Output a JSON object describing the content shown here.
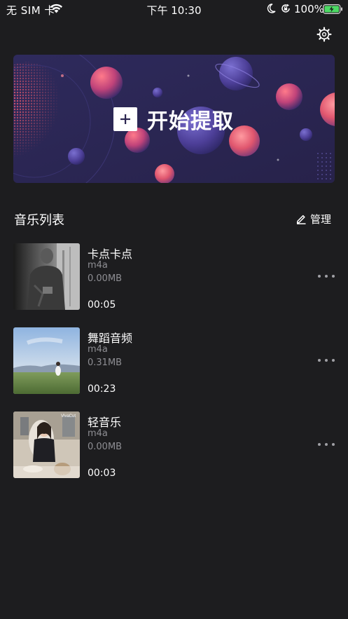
{
  "status_bar": {
    "carrier": "无 SIM 卡",
    "time": "下午 10:30",
    "battery_percent": "100%"
  },
  "icons": {
    "settings": "gear-icon",
    "add": "plus-icon",
    "edit": "pencil-icon",
    "more": "ellipsis-icon"
  },
  "banner": {
    "cta_label": "开始提取"
  },
  "music_list": {
    "title": "音乐列表",
    "manage_label": "管理",
    "tracks": [
      {
        "title": "卡点卡点",
        "format": "m4a",
        "size": "0.00MB",
        "duration": "00:05"
      },
      {
        "title": "舞蹈音频",
        "format": "m4a",
        "size": "0.31MB",
        "duration": "00:23"
      },
      {
        "title": "轻音乐",
        "format": "m4a",
        "size": "0.00MB",
        "duration": "00:03"
      }
    ]
  },
  "thumbnail_watermark": "VivaCut",
  "colors": {
    "background": "#1d1d1f",
    "banner_bg": "#2b2550",
    "accent_pink": "#e0566e",
    "secondary_text": "#8e8e93"
  }
}
